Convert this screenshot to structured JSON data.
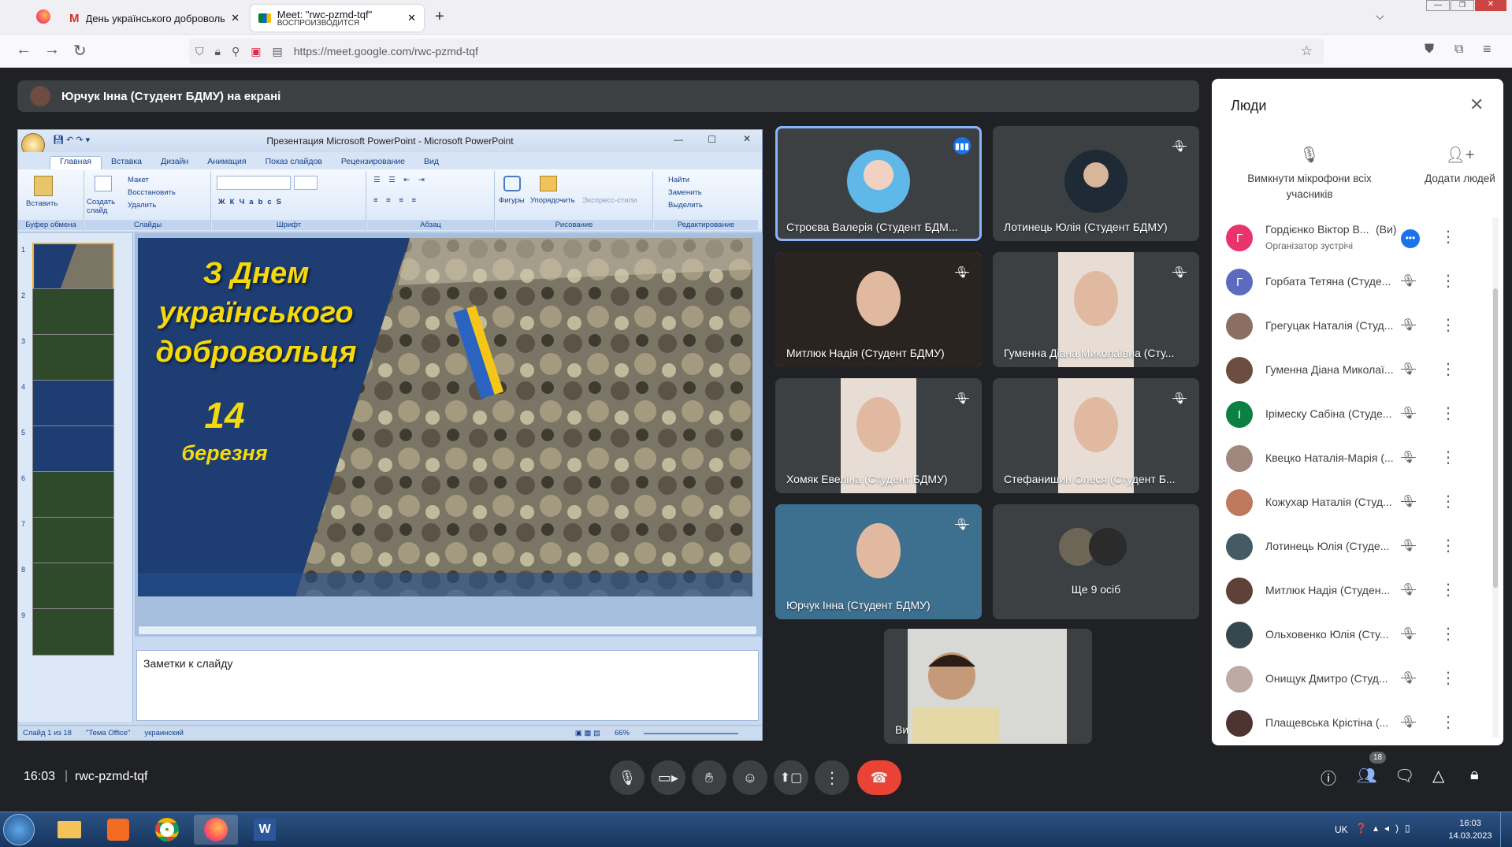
{
  "browser": {
    "tabs": [
      {
        "title": "День українського добровольця",
        "icon": "gmail-icon"
      },
      {
        "title": "Meet: \"rwc-pzmd-tqf\"",
        "subtitle": "ВОСПРОИЗВОДИТСЯ",
        "icon": "meet-icon"
      }
    ],
    "url": "https://meet.google.com/rwc-pzmd-tqf"
  },
  "meet": {
    "presenter_banner": "Юрчук Інна (Студент БДМУ) на екрані",
    "clock": "16:03",
    "meeting_code": "rwc-pzmd-tqf",
    "participant_count": "18",
    "tiles": [
      {
        "name": "Строєва Валерія (Студент БДМ...",
        "mic": "speaking"
      },
      {
        "name": "Лотинець Юлія (Студент БДМУ)",
        "mic": "muted"
      },
      {
        "name": "Митлюк Надія (Студент БДМУ)",
        "mic": "muted"
      },
      {
        "name": "Гуменна Діана Миколаївна (Сту...",
        "mic": "muted"
      },
      {
        "name": "Хомяк Евеліна (Студент БДМУ)",
        "mic": "muted"
      },
      {
        "name": "Стефанишин Олеся (Студент Б...",
        "mic": "muted"
      },
      {
        "name": "Юрчук Інна (Студент БДМУ)",
        "mic": "muted"
      },
      {
        "name": "Ще 9 осіб",
        "mic": "none"
      }
    ],
    "self_tile": {
      "name": "Ви"
    }
  },
  "ppt": {
    "window_title": "Презентация Microsoft PowerPoint - Microsoft PowerPoint",
    "menu": [
      "Главная",
      "Вставка",
      "Дизайн",
      "Анимация",
      "Показ слайдов",
      "Рецензирование",
      "Вид"
    ],
    "ribbon": {
      "paste": "Вставить",
      "new_slide": "Создать слайд",
      "layout": "Макет",
      "restore": "Восстановить",
      "delete": "Удалить",
      "shapes": "Фигуры",
      "arrange": "Упорядочить",
      "quick_styles": "Экспресс-стили",
      "find": "Найти",
      "replace": "Заменить",
      "select": "Выделить",
      "groups": [
        "Буфер обмена",
        "Слайды",
        "Шрифт",
        "Абзац",
        "Рисование",
        "Редактирование"
      ]
    },
    "slide": {
      "line1": "З Днем",
      "line2": "українського",
      "line3": "добровольця",
      "date": "14",
      "month": "березня"
    },
    "thumb_numbers": [
      "1",
      "2",
      "3",
      "4",
      "5",
      "6",
      "7",
      "8",
      "9"
    ],
    "notes_placeholder": "Заметки к слайду",
    "status": {
      "slide": "Слайд 1 из 18",
      "theme": "\"Тема Office\"",
      "lang": "украинский",
      "zoom": "66%"
    }
  },
  "people": {
    "title": "Люди",
    "mute_all": "Вимкнути мікрофони всіх учасників",
    "add_people": "Додати людей",
    "list": [
      {
        "name": "Гордієнко Віктор В...",
        "you": "(Ви)",
        "sub": "Організатор зустрічі",
        "letter": "Г",
        "color": "#e8336b"
      },
      {
        "name": "Горбата Тетяна (Студе...",
        "letter": "Г",
        "color": "#5c6bc0"
      },
      {
        "name": "Грегуцак Наталія (Студ...",
        "letter": "",
        "color": "#8d6e63"
      },
      {
        "name": "Гуменна Діана Миколаї...",
        "letter": "",
        "color": "#6d4c41"
      },
      {
        "name": "Ірімеску Сабіна (Студе...",
        "letter": "І",
        "color": "#0b8043"
      },
      {
        "name": "Квецко Наталія-Марія (...",
        "letter": "",
        "color": "#a1887f"
      },
      {
        "name": "Кожухар Наталія (Студ...",
        "letter": "",
        "color": "#bf7a5e"
      },
      {
        "name": "Лотинець Юлія (Студе...",
        "letter": "",
        "color": "#455a64"
      },
      {
        "name": "Митлюк Надія (Студен...",
        "letter": "",
        "color": "#5d4037"
      },
      {
        "name": "Ольховенко Юлія (Сту...",
        "letter": "",
        "color": "#37474f"
      },
      {
        "name": "Онищук Дмитро (Студ...",
        "letter": "",
        "color": "#bcaaa4"
      },
      {
        "name": "Плащевська Крістіна (...",
        "letter": "",
        "color": "#4e342e"
      }
    ]
  },
  "taskbar": {
    "lang": "UK",
    "time": "16:03",
    "date": "14.03.2023"
  },
  "colors": {
    "meet_blue": "#1a73e8",
    "hangup": "#ea4335",
    "meet_bg": "#202124",
    "tile_bg": "#3c4043"
  }
}
